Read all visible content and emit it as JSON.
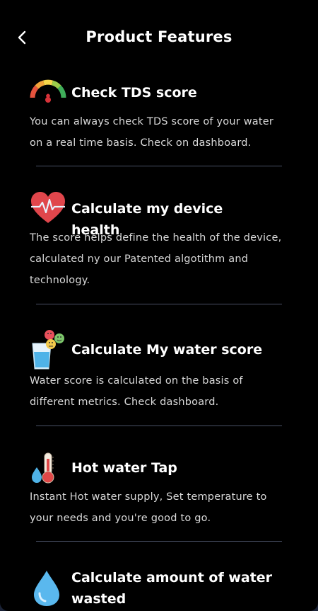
{
  "header": {
    "title": "Product Features",
    "back_icon": "chevron-left-icon"
  },
  "features": [
    {
      "icon": "gauge-icon",
      "title": "Check TDS score",
      "description": "You can always check TDS score of your water on a real time basis. Check on dashboard."
    },
    {
      "icon": "heart-pulse-icon",
      "title": "Calculate my device health",
      "description": "The score helps define the health of the device, calculated ny our Patented algotithm and technology."
    },
    {
      "icon": "water-glass-emoji-icon",
      "title": "Calculate My water score",
      "description": "Water score is calculated on the basis of different metrics. Check dashboard."
    },
    {
      "icon": "thermometer-drop-icon",
      "title": "Hot water Tap",
      "description": "Instant Hot water supply, Set temperature to your needs and you're good to go."
    },
    {
      "icon": "water-drop-icon",
      "title": "Calculate amount of water wasted",
      "description": ""
    }
  ],
  "colors": {
    "background": "#000000",
    "text_primary": "#ffffff",
    "text_secondary": "#d9d9d9",
    "divider": "#4a5166"
  }
}
